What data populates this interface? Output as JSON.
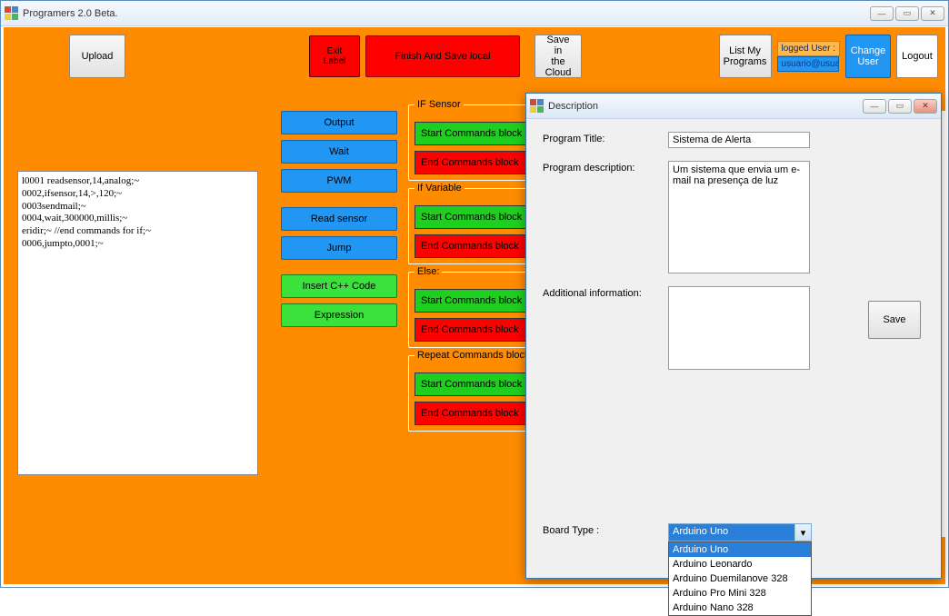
{
  "window": {
    "title": "Programers 2.0 Beta."
  },
  "toolbar": {
    "upload": "Upload",
    "exit_label": "Exit\nLabel",
    "finish_save_local": "Finish And Save local",
    "save_cloud": "Save in\nthe\nCloud",
    "list_programs": "List My\nPrograms",
    "logged_user_label": "logged User :",
    "logged_user_value": "usuario@usua",
    "change_user": "Change\nUser",
    "logout": "Logout"
  },
  "code_box": "l0001 readsensor,14,analog;~\n0002,ifsensor,14,>,120;~\n0003sendmail;~\n0004,wait,300000,millis;~\neridir;~ //end commands for if;~\n0006,jumpto,0001;~",
  "palette": [
    {
      "label": "Output",
      "kind": "blue"
    },
    {
      "label": "Wait",
      "kind": "blue"
    },
    {
      "label": "PWM",
      "kind": "blue"
    },
    {
      "label": "Read sensor",
      "kind": "blue"
    },
    {
      "label": "Jump",
      "kind": "blue"
    },
    {
      "label": "Insert C++ Code",
      "kind": "green"
    },
    {
      "label": "Expression",
      "kind": "green"
    }
  ],
  "groups": [
    {
      "legend": "IF Sensor",
      "start": "Start Commands block",
      "end": "End Commands block"
    },
    {
      "legend": "If Variable",
      "start": "Start Commands block",
      "end": "End Commands block"
    },
    {
      "legend": "Else:",
      "start": "Start Commands block",
      "end": "End Commands block"
    },
    {
      "legend": "Repeat  Commands block",
      "start": "Start Commands block",
      "end": "End Commands block"
    }
  ],
  "dialog": {
    "title": "Description",
    "program_title_label": "Program Title:",
    "program_title_value": "Sistema de Alerta",
    "program_desc_label": "Program description:",
    "program_desc_value": "Um sistema que envia um e-mail na presença de luz",
    "additional_label": "Additional information:",
    "additional_value": "",
    "board_label": "Board Type :",
    "board_selected": "Arduino Uno",
    "board_options": [
      "Arduino Uno",
      "Arduino Leonardo",
      "Arduino Duemilanove 328",
      "Arduino Pro Mini 328",
      "Arduino Nano 328"
    ],
    "save": "Save"
  }
}
